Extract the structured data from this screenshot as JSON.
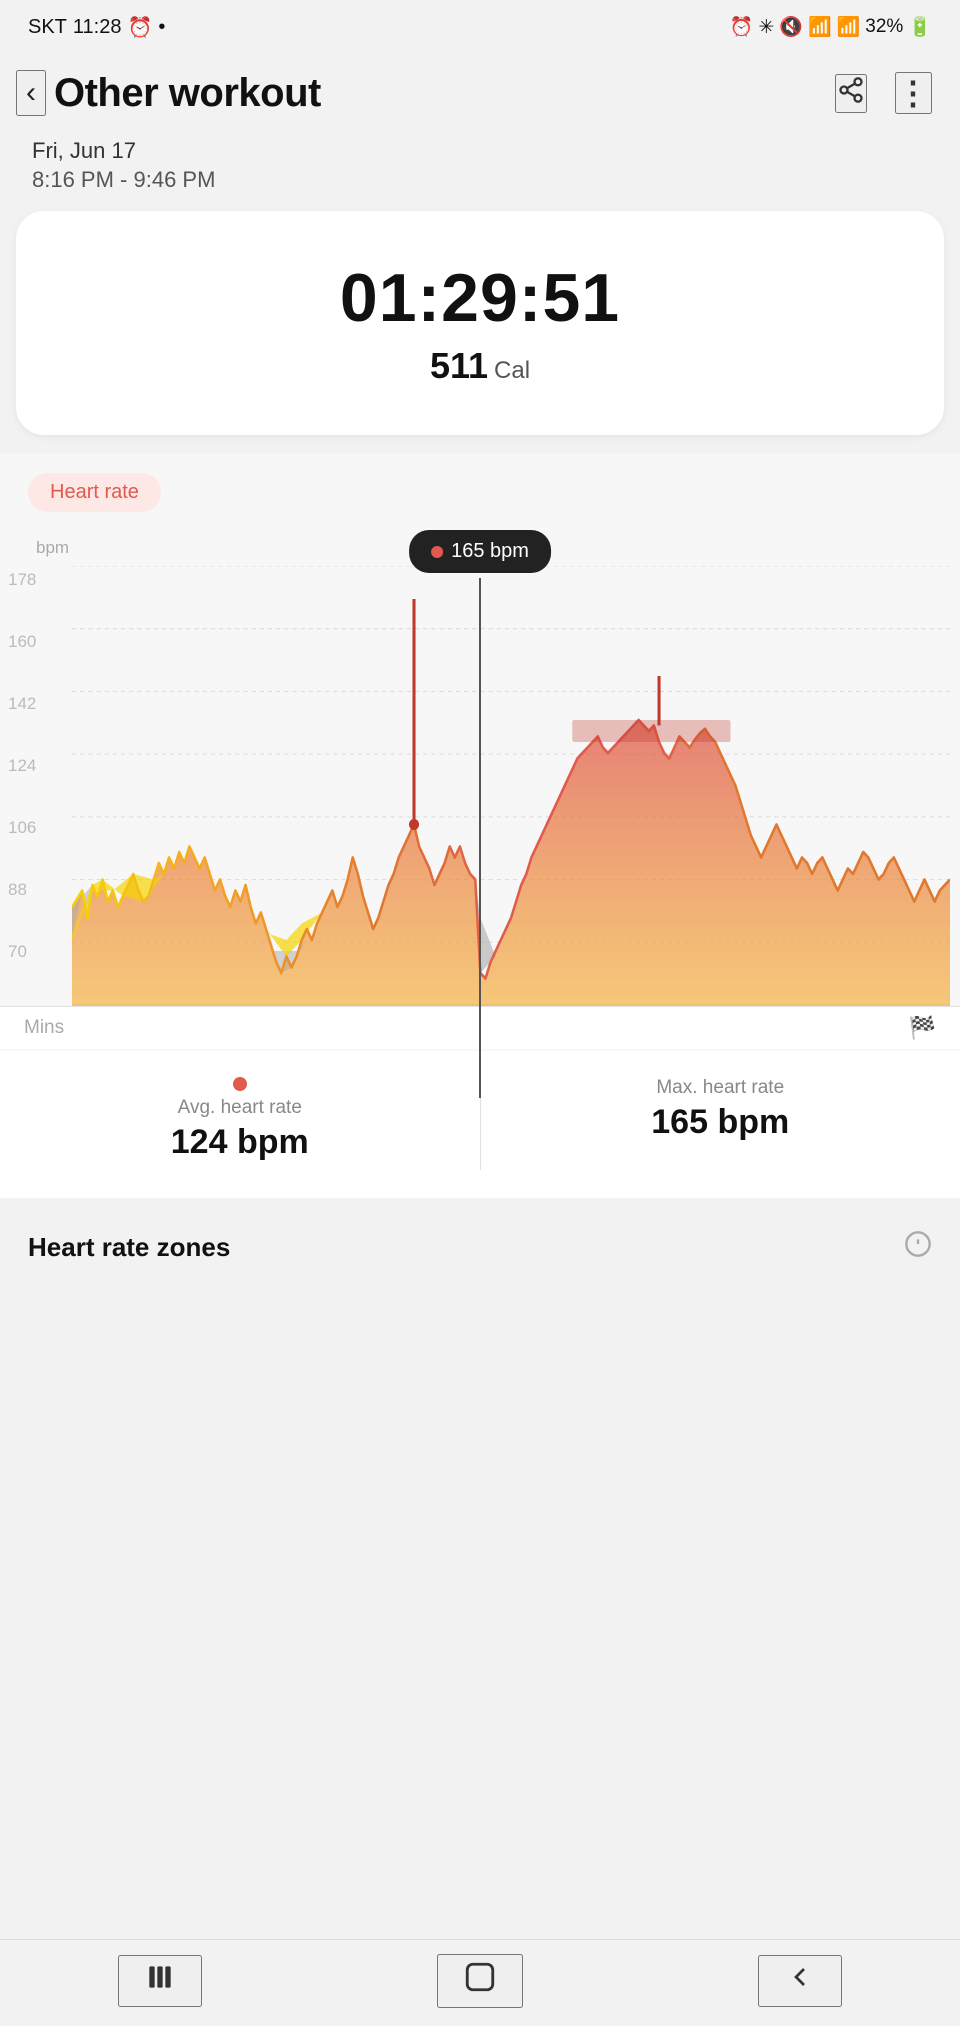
{
  "status_bar": {
    "carrier": "SKT",
    "time": "11:28",
    "battery": "32%",
    "icons": [
      "alarm",
      "bluetooth",
      "mute",
      "wifi",
      "signal"
    ]
  },
  "header": {
    "title": "Other workout",
    "back_label": "‹",
    "share_label": "share",
    "more_label": "⋮"
  },
  "datetime": {
    "date": "Fri, Jun 17",
    "time_range": "8:16 PM - 9:46 PM"
  },
  "summary": {
    "duration": "01:29:51",
    "calories": "511",
    "calories_unit": "Cal"
  },
  "heart_rate_section": {
    "tag_label": "Heart rate",
    "tooltip_bpm": "165 bpm",
    "y_axis_labels": [
      "178",
      "160",
      "142",
      "124",
      "106",
      "88",
      "70"
    ],
    "y_unit": "bpm",
    "x_axis_label": "Mins"
  },
  "stats": {
    "avg_label": "Avg. heart rate",
    "avg_value": "124 bpm",
    "max_label": "Max. heart rate",
    "max_value": "165 bpm"
  },
  "zones": {
    "title": "Heart rate zones",
    "info_label": "ⓘ"
  },
  "nav": {
    "back_btn": "‹",
    "home_btn": "⬜",
    "recent_btn": "◁"
  }
}
